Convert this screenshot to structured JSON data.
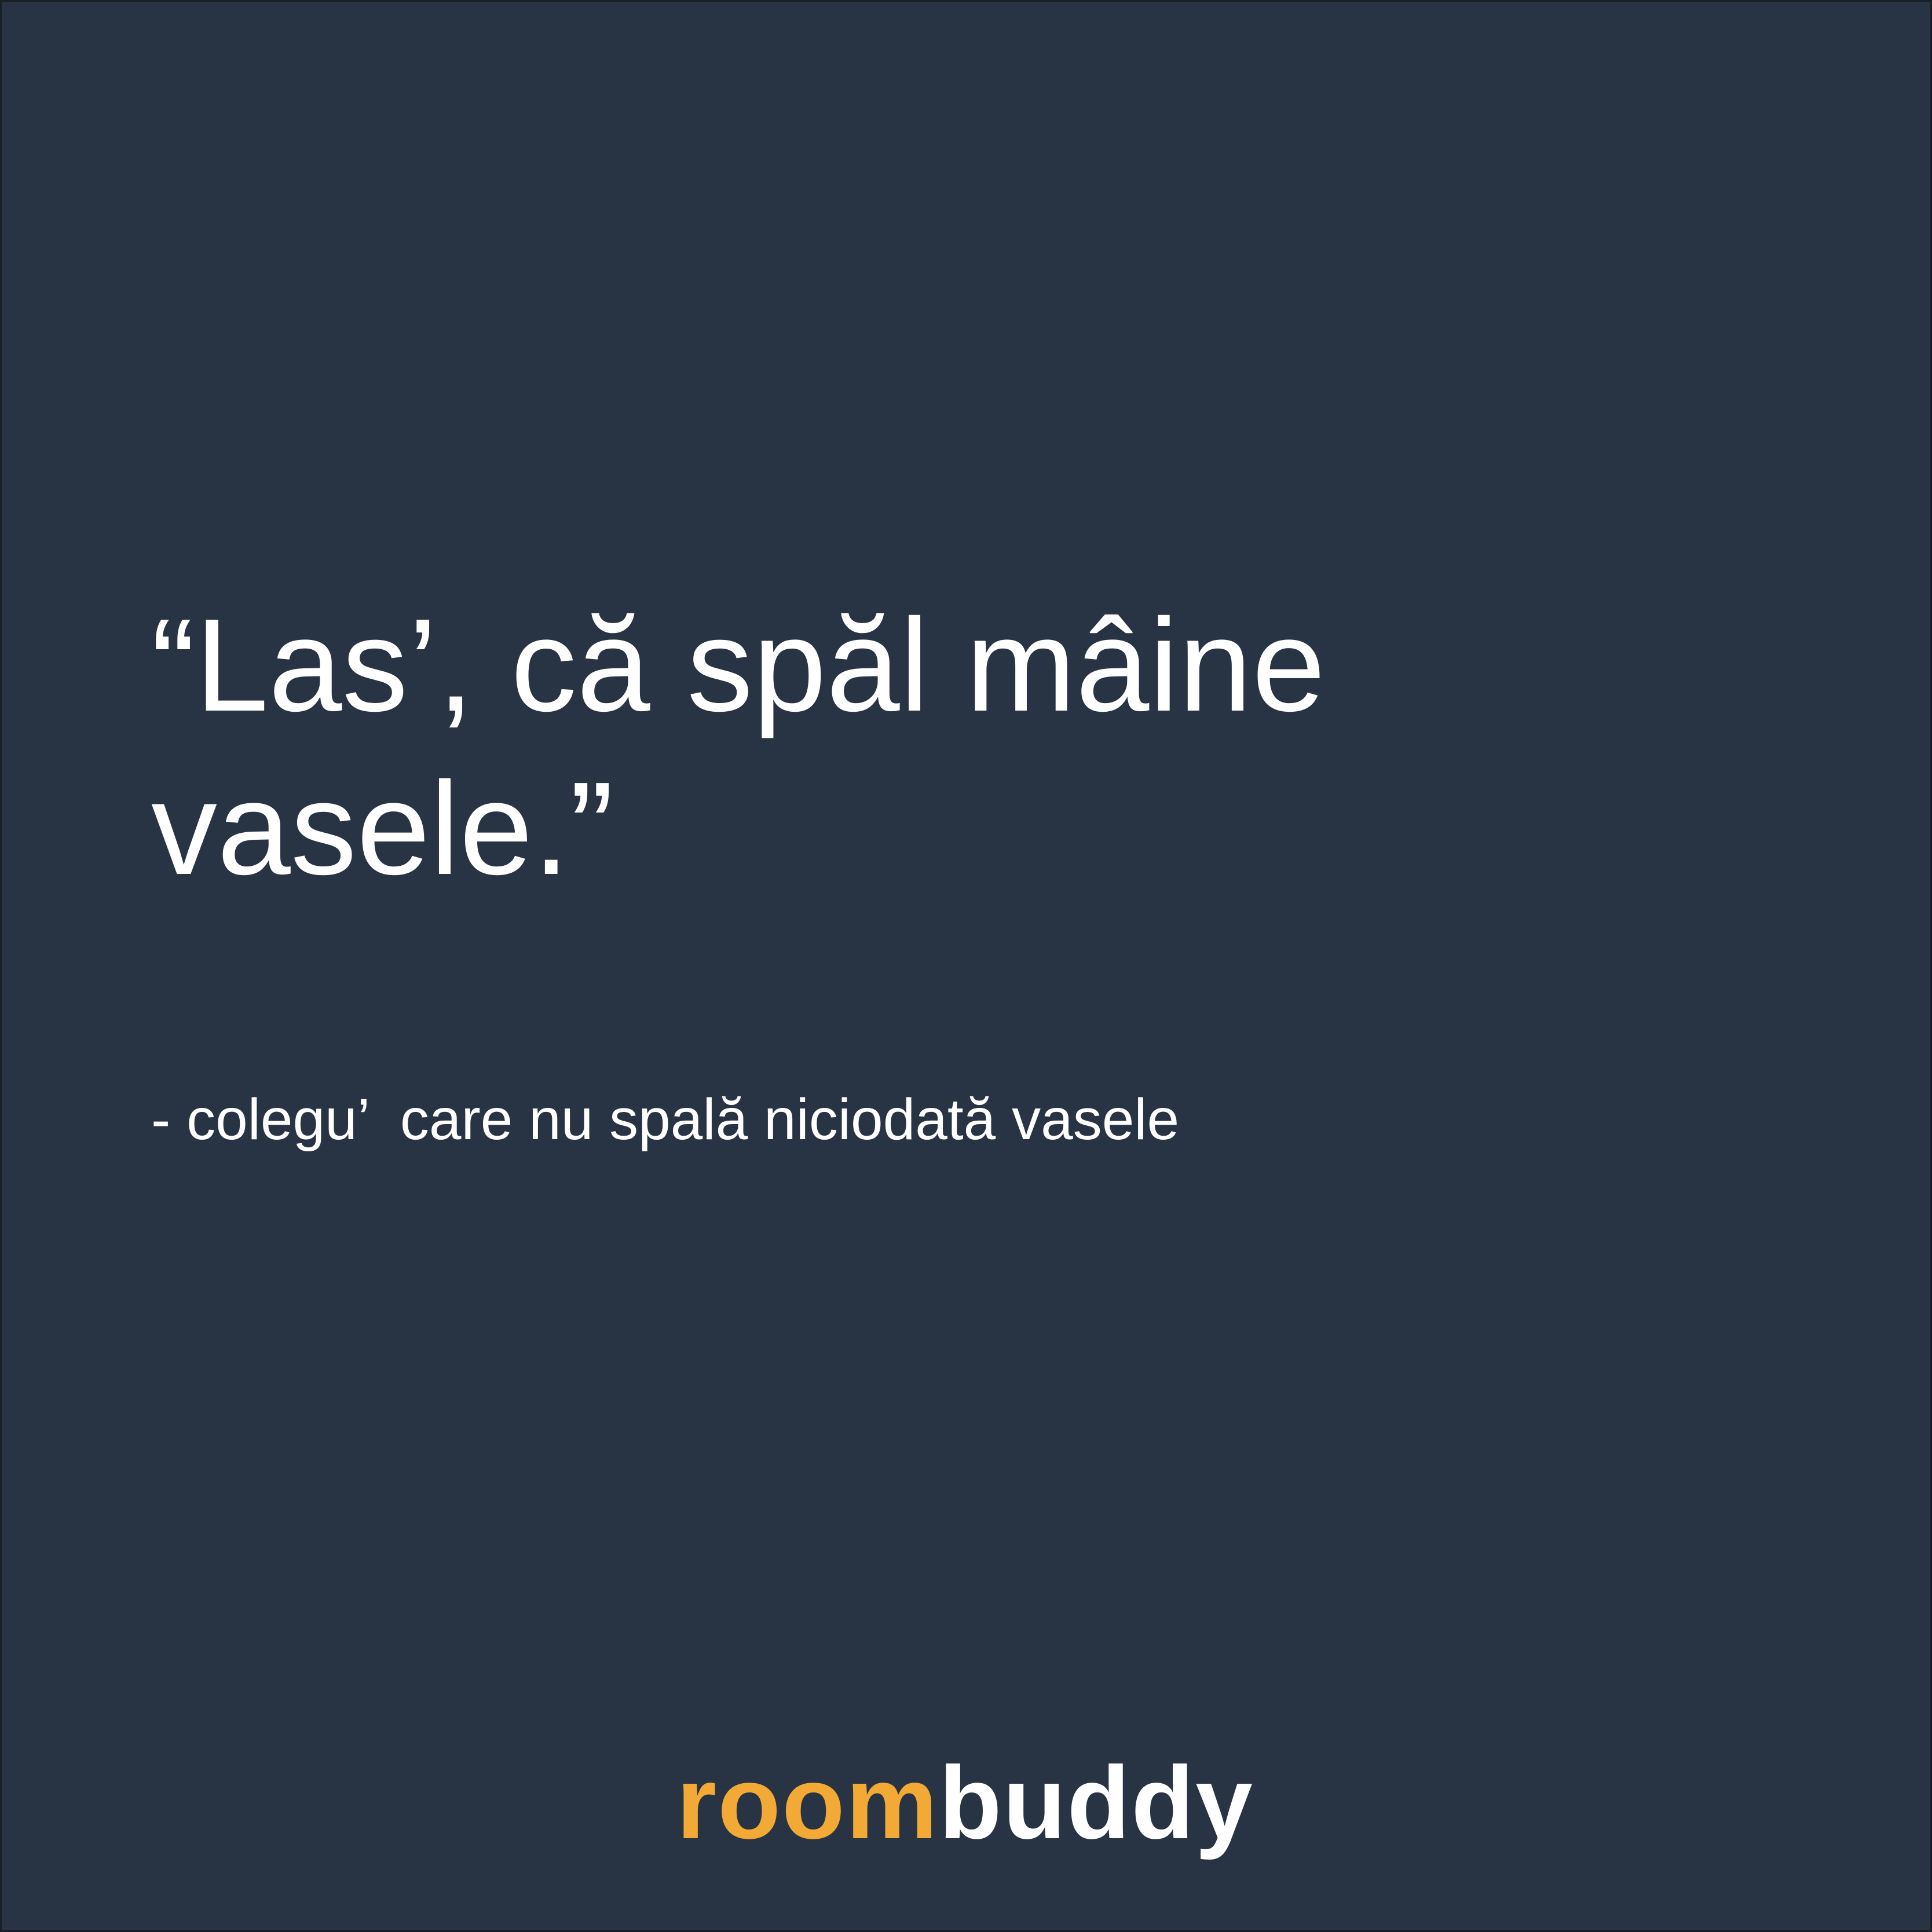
{
  "quote": {
    "line1": "“Las’, că spăl mâine",
    "line2": "vasele.”"
  },
  "attribution": "- colegu’  care nu spală niciodată vasele",
  "logo": {
    "part1": "room",
    "part2": "buddy"
  },
  "colors": {
    "background": "#283343",
    "text": "#ffffff",
    "brand_accent": "#f2a936"
  }
}
